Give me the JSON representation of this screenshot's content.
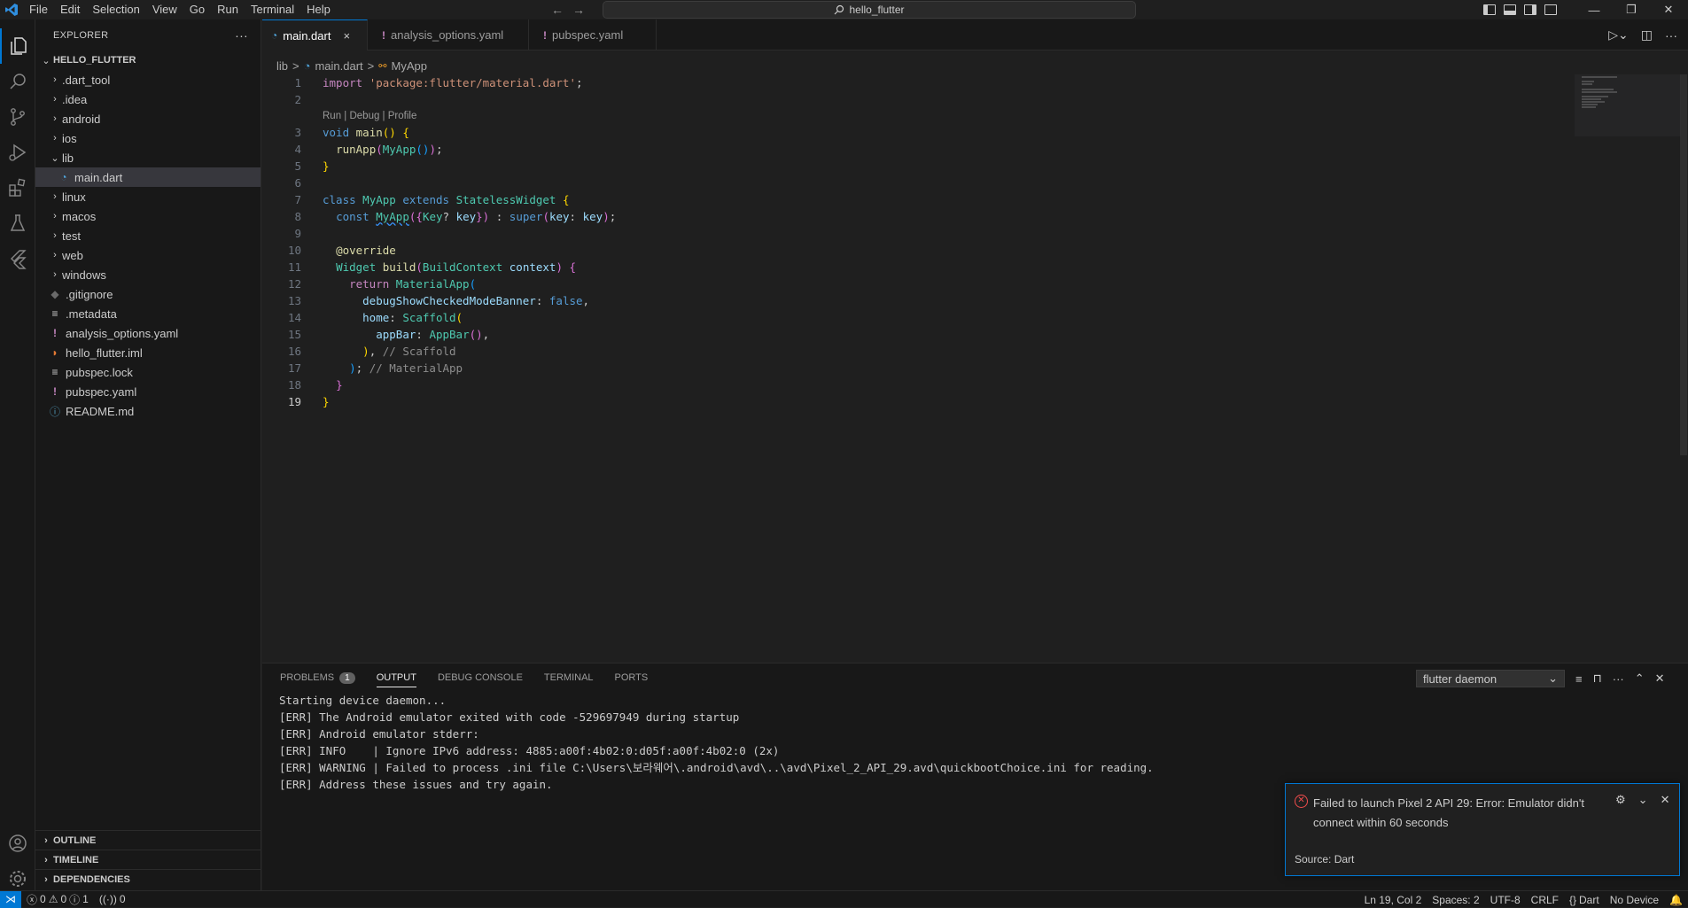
{
  "titlebar": {
    "menu": [
      "File",
      "Edit",
      "Selection",
      "View",
      "Go",
      "Run",
      "Terminal",
      "Help"
    ],
    "search_text": "hello_flutter",
    "logo_icon": "vscode-logo",
    "window_controls": [
      "minimize",
      "restore",
      "close"
    ]
  },
  "explorer": {
    "title": "EXPLORER",
    "more": "···",
    "project": "HELLO_FLUTTER",
    "items": [
      {
        "label": ".dart_tool",
        "type": "folder"
      },
      {
        "label": ".idea",
        "type": "folder"
      },
      {
        "label": "android",
        "type": "folder"
      },
      {
        "label": "ios",
        "type": "folder"
      },
      {
        "label": "lib",
        "type": "folder-open"
      },
      {
        "label": "main.dart",
        "type": "dart-file"
      },
      {
        "label": "linux",
        "type": "folder"
      },
      {
        "label": "macos",
        "type": "folder"
      },
      {
        "label": "test",
        "type": "folder"
      },
      {
        "label": "web",
        "type": "folder"
      },
      {
        "label": "windows",
        "type": "folder"
      },
      {
        "label": ".gitignore",
        "type": "git-file"
      },
      {
        "label": ".metadata",
        "type": "text-file"
      },
      {
        "label": "analysis_options.yaml",
        "type": "yaml-file"
      },
      {
        "label": "hello_flutter.iml",
        "type": "rss-file"
      },
      {
        "label": "pubspec.lock",
        "type": "text-file"
      },
      {
        "label": "pubspec.yaml",
        "type": "yaml-file"
      },
      {
        "label": "README.md",
        "type": "info-file"
      }
    ],
    "sections": [
      "OUTLINE",
      "TIMELINE",
      "DEPENDENCIES"
    ]
  },
  "tabs": [
    {
      "label": "main.dart",
      "icon": "dart-icon",
      "active": true,
      "close": "×"
    },
    {
      "label": "analysis_options.yaml",
      "icon": "exclamation-icon",
      "active": false
    },
    {
      "label": "pubspec.yaml",
      "icon": "exclamation-icon",
      "active": false
    }
  ],
  "breadcrumb": {
    "parts": [
      "lib",
      "main.dart",
      "MyApp"
    ],
    "sep": ">"
  },
  "editor": {
    "codelens": "Run | Debug | Profile",
    "line_numbers": [
      "1",
      "2",
      "3",
      "4",
      "5",
      "6",
      "7",
      "8",
      "9",
      "10",
      "11",
      "12",
      "13",
      "14",
      "15",
      "16",
      "17",
      "18",
      "19"
    ],
    "current_line": "19"
  },
  "panel": {
    "tabs": [
      "PROBLEMS",
      "OUTPUT",
      "DEBUG CONSOLE",
      "TERMINAL",
      "PORTS"
    ],
    "problems_count": "1",
    "output_channel": "flutter daemon",
    "output_lines": [
      "Starting device daemon...",
      "[ERR] The Android emulator exited with code -529697949 during startup",
      "[ERR] Android emulator stderr:",
      "[ERR] INFO    | Ignore IPv6 address: 4885:a00f:4b02:0:d05f:a00f:4b02:0 (2x)",
      "[ERR] WARNING | Failed to process .ini file C:\\Users\\보라웨어\\.android\\avd\\..\\avd\\Pixel_2_API_29.avd\\quickbootChoice.ini for reading.",
      "[ERR] Address these issues and try again."
    ]
  },
  "notification": {
    "message": "Failed to launch Pixel 2 API 29: Error: Emulator didn't connect within 60 seconds",
    "source": "Source: Dart"
  },
  "statusbar": {
    "errors": "0",
    "warnings": "0",
    "info": "1",
    "ports": "0",
    "position": "Ln 19, Col 2",
    "spaces": "Spaces: 2",
    "encoding": "UTF-8",
    "eol": "CRLF",
    "language": "Dart",
    "device": "No Device"
  },
  "colors": {
    "accent": "#0078d4",
    "error": "#f14c4c",
    "background": "#1f1f1f"
  }
}
